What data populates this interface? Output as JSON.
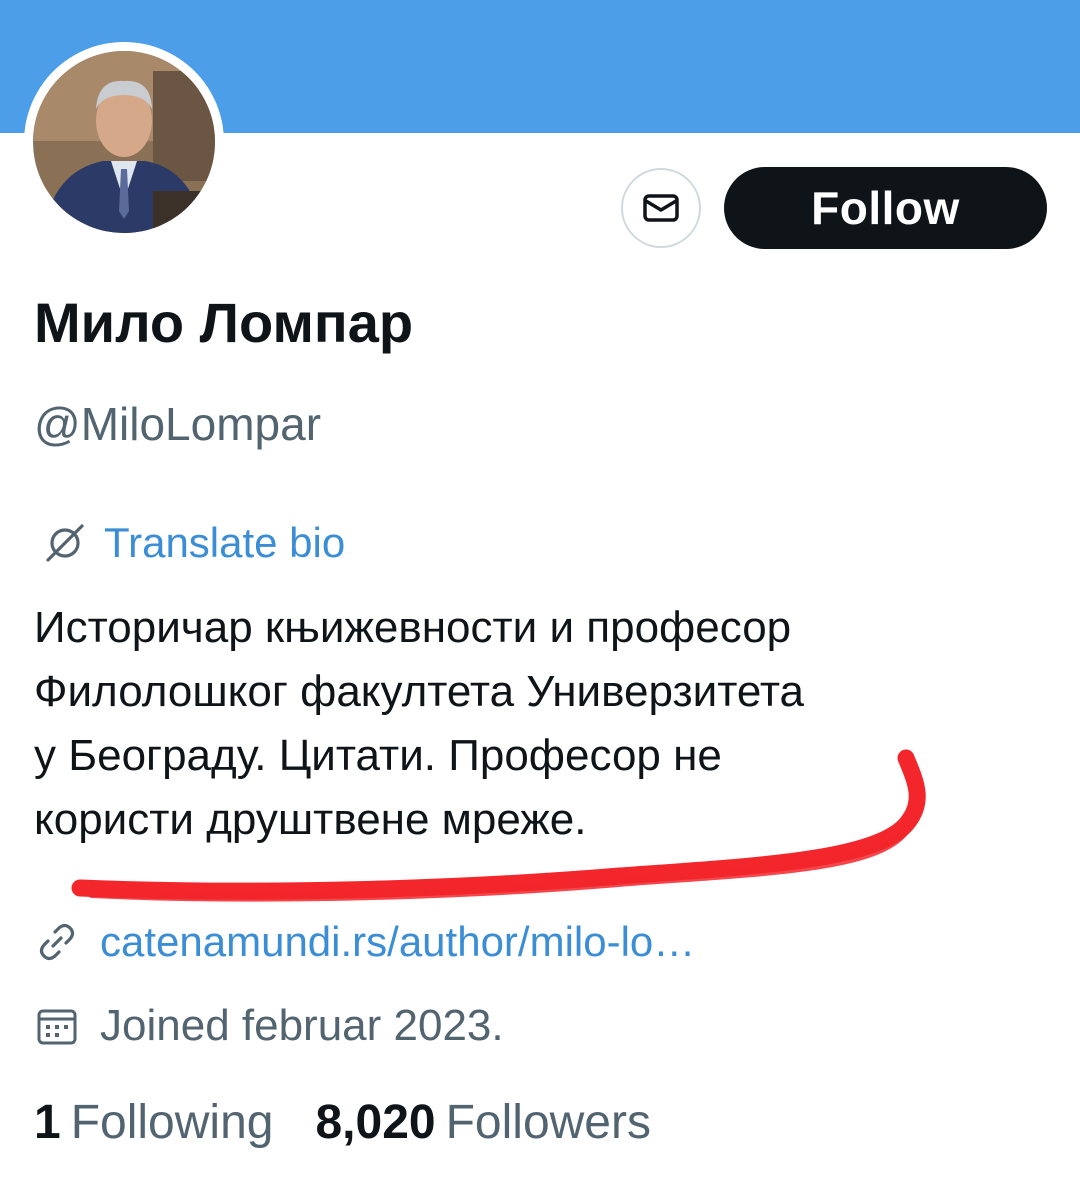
{
  "header": {
    "banner_color": "#4d9ee8"
  },
  "profile": {
    "display_name": "Мило Ломпар",
    "handle": "@MiloLompar",
    "follow_label": "Follow",
    "translate_label": "Translate bio",
    "bio_lines": [
      "Историчар књижевности и професор",
      "Филолошког факултета Универзитета",
      "у Београду.  Цитати.  Професор не",
      "користи друштвене мреже."
    ],
    "website": "catenamundi.rs/author/milo-lo…",
    "joined": "Joined februar 2023.",
    "following_count": "1",
    "following_label": "Following",
    "followers_count": "8,020",
    "followers_label": "Followers"
  },
  "icons": {
    "message": "envelope-icon",
    "translate": "translate-icon",
    "link": "link-icon",
    "calendar": "calendar-icon"
  },
  "colors": {
    "accent": "#3b8ed6",
    "follow_button": "#0f1419",
    "annotation": "#f2262b"
  }
}
